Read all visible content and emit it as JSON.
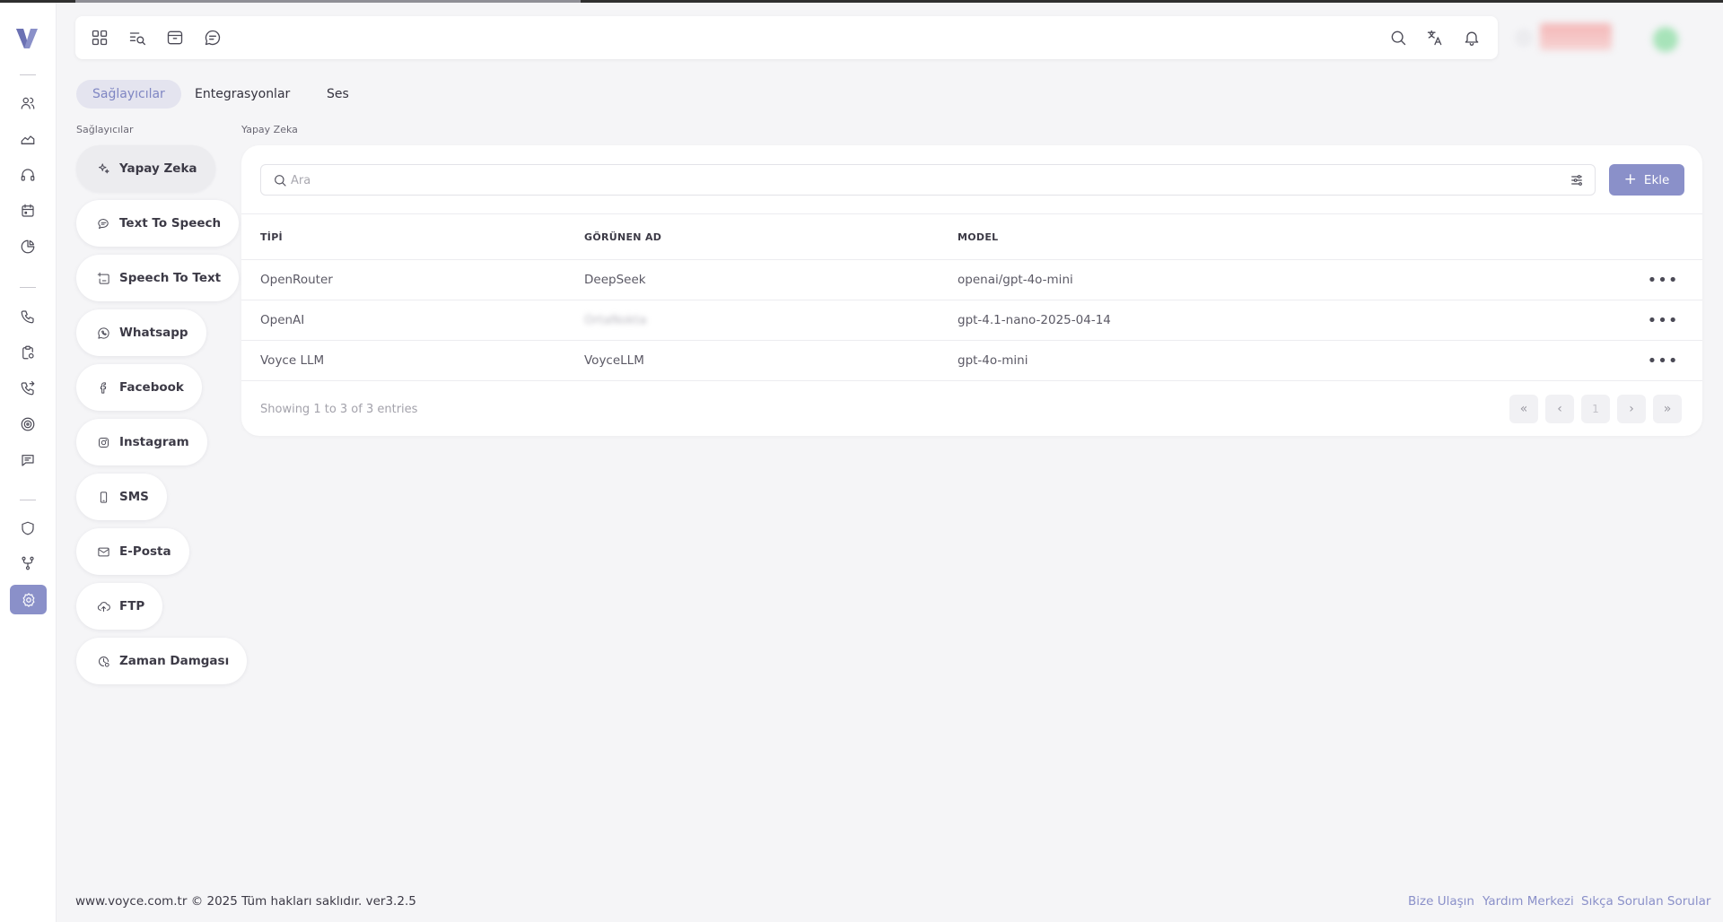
{
  "app": {
    "brand_color": "#8a90c9"
  },
  "sidebar": {
    "icons": [
      "logo",
      "users-icon",
      "chart-area-icon",
      "headphones-icon",
      "calendar-icon",
      "pie-chart-icon",
      "phone-icon",
      "clipboard-icon",
      "phone-forward-icon",
      "target-icon",
      "message-icon",
      "shield-icon",
      "git-branch-icon",
      "settings-icon"
    ],
    "active": "settings-icon"
  },
  "navbar": {
    "left_icons": [
      "dashboard-icon",
      "search-list-icon",
      "archive-icon",
      "chat-icon"
    ],
    "right_icons": [
      "search-icon",
      "translate-icon",
      "bell-icon"
    ]
  },
  "tabs": [
    {
      "label": "Sağlayıcılar",
      "active": true
    },
    {
      "label": "Entegrasyonlar",
      "active": false
    },
    {
      "label": "Ses",
      "active": false
    }
  ],
  "providers": {
    "section_label": "Sağlayıcılar",
    "items": [
      {
        "label": "Yapay Zeka",
        "icon": "sparkle-icon",
        "active": true
      },
      {
        "label": "Text To Speech",
        "icon": "speech-bubble-icon",
        "active": false
      },
      {
        "label": "Speech To Text",
        "icon": "text-insert-icon",
        "active": false
      },
      {
        "label": "Whatsapp",
        "icon": "whatsapp-icon",
        "active": false
      },
      {
        "label": "Facebook",
        "icon": "facebook-icon",
        "active": false
      },
      {
        "label": "Instagram",
        "icon": "instagram-icon",
        "active": false
      },
      {
        "label": "SMS",
        "icon": "mobile-icon",
        "active": false
      },
      {
        "label": "E-Posta",
        "icon": "mail-icon",
        "active": false
      },
      {
        "label": "FTP",
        "icon": "cloud-upload-icon",
        "active": false
      },
      {
        "label": "Zaman Damgası",
        "icon": "time-stamp-icon",
        "active": false
      }
    ]
  },
  "content": {
    "section_label": "Yapay Zeka",
    "search": {
      "placeholder": "Ara",
      "value": ""
    },
    "add_button": "Ekle",
    "table": {
      "columns": [
        "TİPİ",
        "GÖRÜNEN AD",
        "MODEL"
      ],
      "rows": [
        {
          "type": "OpenRouter",
          "display_name": "DeepSeek",
          "model": "openai/gpt-4o-mini",
          "blurred": false
        },
        {
          "type": "OpenAI",
          "display_name": "OrtaNokta",
          "model": "gpt-4.1-nano-2025-04-14",
          "blurred": true
        },
        {
          "type": "Voyce LLM",
          "display_name": "VoyceLLM",
          "model": "gpt-4o-mini",
          "blurred": false
        }
      ]
    },
    "pagination": {
      "info": "Showing 1 to 3 of 3 entries",
      "first": "«",
      "prev": "‹",
      "current": "1",
      "next": "›",
      "last": "»"
    }
  },
  "footer": {
    "copyright": "www.voyce.com.tr © 2025 Tüm hakları saklıdır. ver3.2.5",
    "links": [
      "Bize Ulaşın",
      "Yardım Merkezi",
      "Sıkça Sorulan Sorular"
    ]
  }
}
